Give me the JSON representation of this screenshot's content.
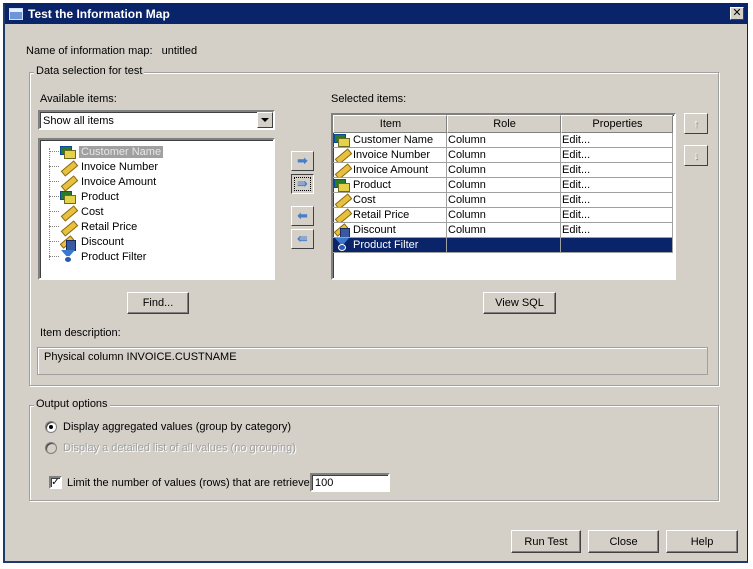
{
  "window": {
    "title": "Test the Information Map",
    "close_glyph": "✕"
  },
  "info_map": {
    "label": "Name of information map:",
    "value": "untitled"
  },
  "data_selection": {
    "legend": "Data selection for test",
    "available": {
      "label": "Available items:",
      "filter_value": "Show all items",
      "items": [
        {
          "label": "Customer Name",
          "icon": "category-icon",
          "selected": true
        },
        {
          "label": "Invoice Number",
          "icon": "measure-icon"
        },
        {
          "label": "Invoice Amount",
          "icon": "measure-icon"
        },
        {
          "label": "Product",
          "icon": "category-icon"
        },
        {
          "label": "Cost",
          "icon": "measure-icon"
        },
        {
          "label": "Retail Price",
          "icon": "measure-icon"
        },
        {
          "label": "Discount",
          "icon": "calculated-measure-icon"
        },
        {
          "label": "Product Filter",
          "icon": "filter-icon"
        }
      ],
      "find_button": "Find..."
    },
    "move_buttons": {
      "add": "➡",
      "add_all": "⇛",
      "remove": "⬅",
      "remove_all": "⇚"
    },
    "selected": {
      "label": "Selected items:",
      "columns": [
        "Item",
        "Role",
        "Properties"
      ],
      "rows": [
        {
          "item": "Customer Name",
          "icon": "category-icon",
          "role": "Column",
          "properties": "Edit..."
        },
        {
          "item": "Invoice Number",
          "icon": "measure-icon",
          "role": "Column",
          "properties": "Edit..."
        },
        {
          "item": "Invoice Amount",
          "icon": "measure-icon",
          "role": "Column",
          "properties": "Edit..."
        },
        {
          "item": "Product",
          "icon": "category-icon",
          "role": "Column",
          "properties": "Edit..."
        },
        {
          "item": "Cost",
          "icon": "measure-icon",
          "role": "Column",
          "properties": "Edit..."
        },
        {
          "item": "Retail Price",
          "icon": "measure-icon",
          "role": "Column",
          "properties": "Edit..."
        },
        {
          "item": "Discount",
          "icon": "calculated-measure-icon",
          "role": "Column",
          "properties": "Edit..."
        },
        {
          "item": "Product Filter",
          "icon": "filter-icon",
          "role": "",
          "properties": "",
          "selected": true
        }
      ],
      "move_up_glyph": "↑",
      "move_down_glyph": "↓",
      "view_sql_button": "View SQL"
    },
    "description": {
      "label": "Item description:",
      "value": "Physical column INVOICE.CUSTNAME"
    }
  },
  "output_options": {
    "legend": "Output options",
    "radio_aggregated": "Display aggregated values (group by category)",
    "radio_detailed": "Display a detailed list of all values (no grouping)",
    "selected_option": "aggregated",
    "limit_checkbox": "Limit the number of values (rows) that are retrieved:",
    "limit_checked": true,
    "limit_value": "100",
    "check_glyph": "✓"
  },
  "footer": {
    "run_test": "Run Test",
    "close": "Close",
    "help": "Help"
  }
}
